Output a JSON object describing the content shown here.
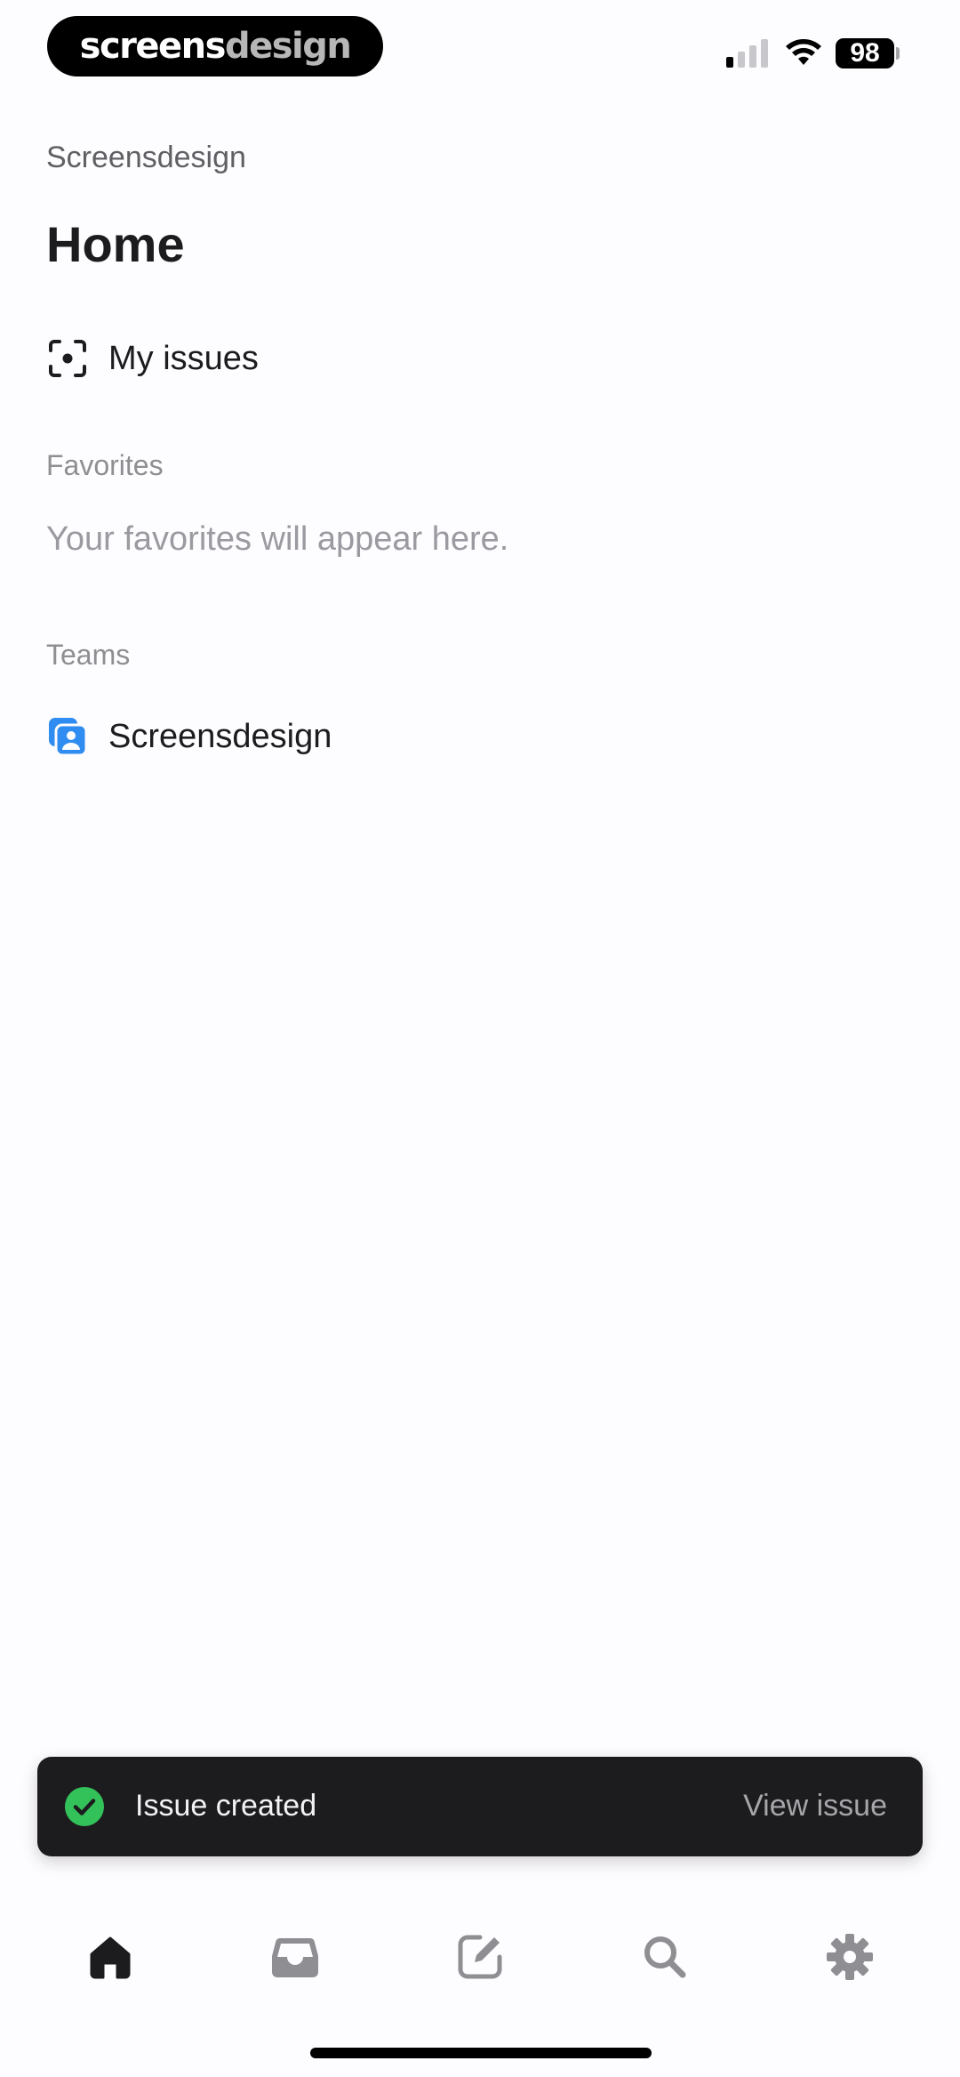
{
  "status_bar": {
    "brand_primary": "screens",
    "brand_secondary": "design",
    "battery": "98"
  },
  "header": {
    "workspace": "Screensdesign",
    "title": "Home"
  },
  "nav": {
    "my_issues_label": "My issues"
  },
  "favorites": {
    "heading": "Favorites",
    "empty_text": "Your favorites will appear here."
  },
  "teams": {
    "heading": "Teams",
    "items": [
      {
        "label": "Screensdesign",
        "icon": "team-icon"
      }
    ]
  },
  "toast": {
    "message": "Issue created",
    "action": "View issue"
  },
  "tab_bar": {
    "tabs": [
      {
        "name": "home",
        "icon": "home-icon",
        "active": true
      },
      {
        "name": "inbox",
        "icon": "inbox-icon",
        "active": false
      },
      {
        "name": "new-issue",
        "icon": "compose-icon",
        "active": false
      },
      {
        "name": "search",
        "icon": "search-icon",
        "active": false
      },
      {
        "name": "settings",
        "icon": "gear-icon",
        "active": false
      }
    ]
  },
  "colors": {
    "accent": "#2f8cf0",
    "success": "#33c15a",
    "toast_bg": "#1c1c1e",
    "tab_active": "#1c1c1e",
    "tab_inactive": "#8e8e93"
  }
}
